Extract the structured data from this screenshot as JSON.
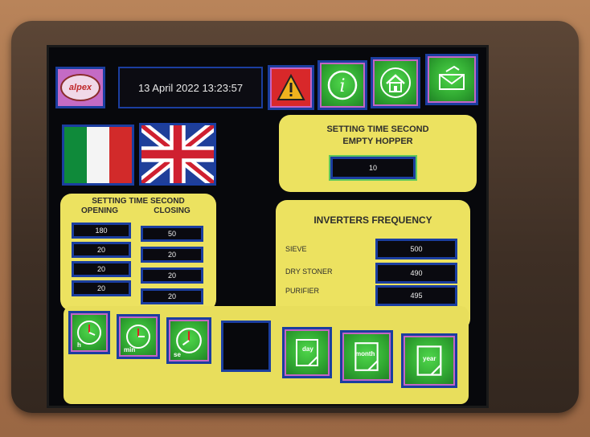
{
  "header": {
    "logo_text": "alpex",
    "datetime": "13 April 2022 13:23:57",
    "icons": [
      "warning-icon",
      "info-icon",
      "home-icon",
      "mail-icon"
    ]
  },
  "languages": [
    "italian-flag",
    "uk-flag"
  ],
  "hopper": {
    "title_line1": "SETTING TIME SECOND",
    "title_line2": "EMPTY HOPPER",
    "value": "10"
  },
  "gates": {
    "title": "SETTING TIME SECOND",
    "opening_label": "OPENING",
    "closing_label": "CLOSING",
    "opening": [
      "180",
      "20",
      "20",
      "20"
    ],
    "closing": [
      "50",
      "20",
      "20",
      "20"
    ]
  },
  "inverters": {
    "title": "INVERTERS FREQUENCY",
    "rows": [
      {
        "label": "SIEVE",
        "value": "500"
      },
      {
        "label": "DRY STONER",
        "value": "490"
      },
      {
        "label": "PURIFIER",
        "value": "495"
      }
    ]
  },
  "bottom": {
    "clock_labels": [
      "h",
      "min",
      "se"
    ],
    "report_labels": [
      "day",
      "month",
      "year"
    ]
  },
  "colors": {
    "panel_yellow": "#ece260",
    "tile_green": "#31a932",
    "border_blue": "#1b3ea0",
    "accent_pink": "#c465c4"
  }
}
